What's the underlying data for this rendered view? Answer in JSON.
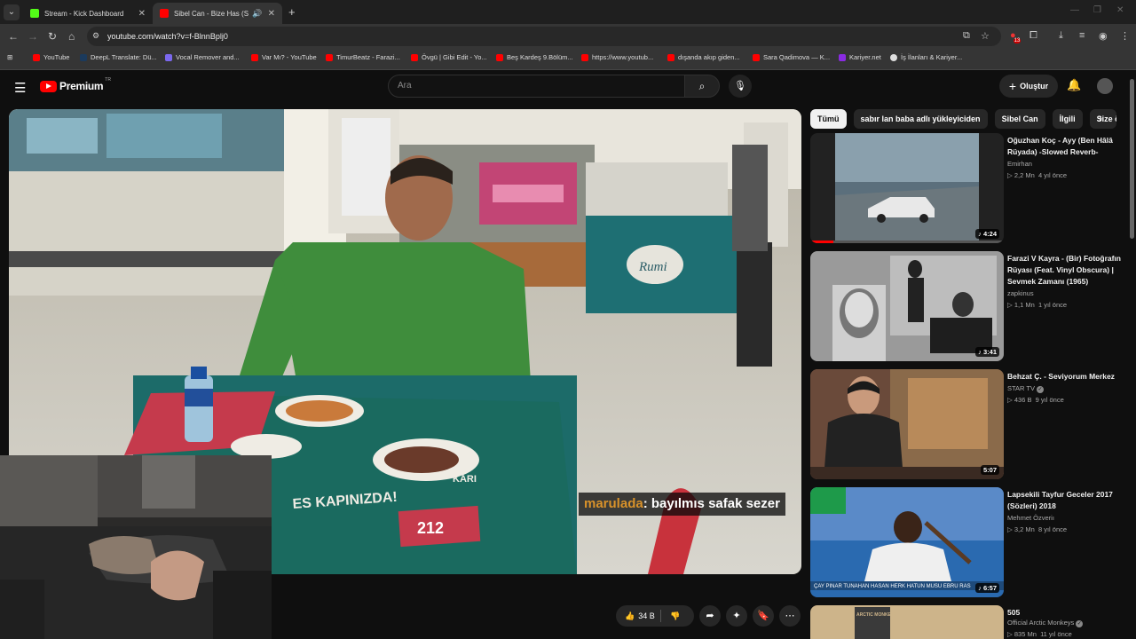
{
  "browser": {
    "tabs": [
      {
        "title": "Stream - Kick Dashboard",
        "active": false
      },
      {
        "title": "Sibel Can - Bize Has (Slowe",
        "active": true
      }
    ],
    "url": "youtube.com/watch?v=f-BlnnBplj0",
    "bookmarks": [
      {
        "label": "YouTube",
        "color": "#ff0000"
      },
      {
        "label": "DeepL Translate: Dü...",
        "color": "#1b3a5c"
      },
      {
        "label": "Vocal Remover and...",
        "color": "#7b68ee"
      },
      {
        "label": "Var Mı? - YouTube",
        "color": "#ff0000"
      },
      {
        "label": "TimurBeatz - Farazi...",
        "color": "#ff0000"
      },
      {
        "label": "Övgü | Gibi Edit - Yo...",
        "color": "#ff0000"
      },
      {
        "label": "Beş Kardeş 9.Bölüm...",
        "color": "#ff0000"
      },
      {
        "label": "https://www.youtub...",
        "color": "#ff0000"
      },
      {
        "label": "dışanda akıp giden...",
        "color": "#ff0000"
      },
      {
        "label": "Sara Qadimova — K...",
        "color": "#ff0000"
      },
      {
        "label": "Kariyer.net",
        "color": "#8a2be2"
      },
      {
        "label": "İş İlanları & Kariyer...",
        "color": "#dddddd"
      }
    ],
    "extension_badge": "13"
  },
  "youtube": {
    "brand": "Premium",
    "brand_suffix": "TR",
    "search_placeholder": "Ara",
    "create_label": "Oluştur",
    "chips": [
      "Tümü",
      "sabır lan baba adlı yükleyiciden",
      "Sibel Can",
      "İlgili",
      "Size öz"
    ],
    "like_count": "34 B",
    "caption": {
      "user": "marulada",
      "text": ": bayılmıs safak sezer"
    },
    "recommendations": [
      {
        "title": "Oğuzhan Koç - Ayy (Ben Hâlâ Rüyada) -Slowed Reverb-",
        "channel": "Emirhan",
        "views": "2,2 Mn",
        "age": "4 yıl önce",
        "duration": "4:24",
        "verified": false,
        "watched": 0.12
      },
      {
        "title": "Farazi V Kayra - (Bir) Fotoğrafın Rüyası (Feat. Vinyl Obscura) | Sevmek Zamanı (1965)",
        "channel": "zapkinus",
        "views": "1,1 Mn",
        "age": "1 yıl önce",
        "duration": "3:41",
        "verified": false,
        "watched": 0
      },
      {
        "title": "Behzat Ç. - Seviyorum Merkez",
        "channel": "STAR TV",
        "views": "436 B",
        "age": "9 yıl önce",
        "duration": "5:07",
        "verified": true,
        "watched": 0
      },
      {
        "title": "Lapsekili Tayfur Geceler 2017 (Sözleri) 2018",
        "channel": "Mehmet Özveriı",
        "views": "3,2 Mn",
        "age": "8 yıl önce",
        "duration": "6:57",
        "verified": false,
        "watched": 0
      },
      {
        "title": "505",
        "channel": "Official Arctic Monkeys",
        "views": "835 Mn",
        "age": "11 yıl önce",
        "duration": "",
        "verified": true,
        "watched": 0
      }
    ]
  },
  "video_overlay_text": {
    "sign": "Rumi",
    "mat1": "KARI",
    "mat2": "ES KAPINIZDA!",
    "mat3": "212"
  },
  "thumb_text": {
    "t4_overlay": "ÇAY PINAR TUNAHAN HASAN HERK HATUN MUSU EBRU RAS",
    "t5_text": "ARCTIC MONKEYS"
  },
  "colors": {
    "brand_red": "#ff0000",
    "kick_green": "#53fc18",
    "chat_user": "#d9922a"
  }
}
